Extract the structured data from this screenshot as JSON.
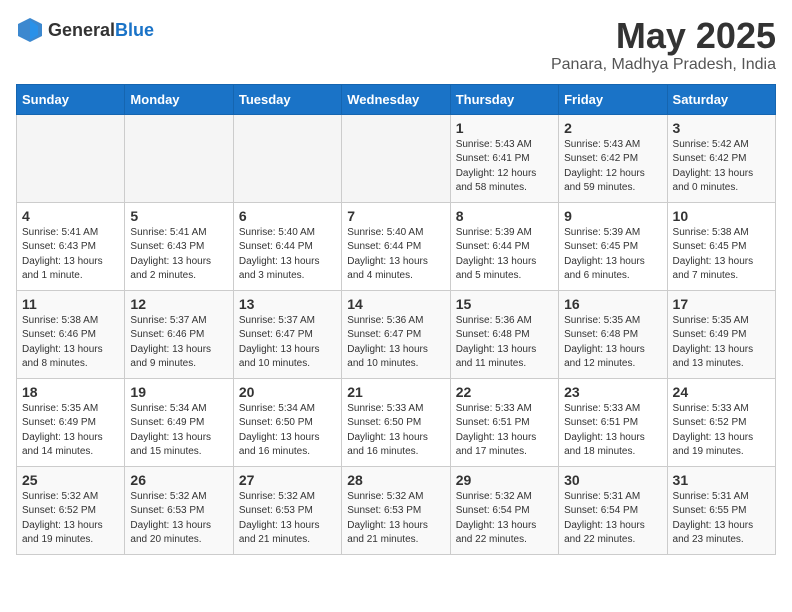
{
  "header": {
    "logo_general": "General",
    "logo_blue": "Blue",
    "month_year": "May 2025",
    "location": "Panara, Madhya Pradesh, India"
  },
  "weekdays": [
    "Sunday",
    "Monday",
    "Tuesday",
    "Wednesday",
    "Thursday",
    "Friday",
    "Saturday"
  ],
  "weeks": [
    [
      {
        "day": "",
        "info": ""
      },
      {
        "day": "",
        "info": ""
      },
      {
        "day": "",
        "info": ""
      },
      {
        "day": "",
        "info": ""
      },
      {
        "day": "1",
        "info": "Sunrise: 5:43 AM\nSunset: 6:41 PM\nDaylight: 12 hours\nand 58 minutes."
      },
      {
        "day": "2",
        "info": "Sunrise: 5:43 AM\nSunset: 6:42 PM\nDaylight: 12 hours\nand 59 minutes."
      },
      {
        "day": "3",
        "info": "Sunrise: 5:42 AM\nSunset: 6:42 PM\nDaylight: 13 hours\nand 0 minutes."
      }
    ],
    [
      {
        "day": "4",
        "info": "Sunrise: 5:41 AM\nSunset: 6:43 PM\nDaylight: 13 hours\nand 1 minute."
      },
      {
        "day": "5",
        "info": "Sunrise: 5:41 AM\nSunset: 6:43 PM\nDaylight: 13 hours\nand 2 minutes."
      },
      {
        "day": "6",
        "info": "Sunrise: 5:40 AM\nSunset: 6:44 PM\nDaylight: 13 hours\nand 3 minutes."
      },
      {
        "day": "7",
        "info": "Sunrise: 5:40 AM\nSunset: 6:44 PM\nDaylight: 13 hours\nand 4 minutes."
      },
      {
        "day": "8",
        "info": "Sunrise: 5:39 AM\nSunset: 6:44 PM\nDaylight: 13 hours\nand 5 minutes."
      },
      {
        "day": "9",
        "info": "Sunrise: 5:39 AM\nSunset: 6:45 PM\nDaylight: 13 hours\nand 6 minutes."
      },
      {
        "day": "10",
        "info": "Sunrise: 5:38 AM\nSunset: 6:45 PM\nDaylight: 13 hours\nand 7 minutes."
      }
    ],
    [
      {
        "day": "11",
        "info": "Sunrise: 5:38 AM\nSunset: 6:46 PM\nDaylight: 13 hours\nand 8 minutes."
      },
      {
        "day": "12",
        "info": "Sunrise: 5:37 AM\nSunset: 6:46 PM\nDaylight: 13 hours\nand 9 minutes."
      },
      {
        "day": "13",
        "info": "Sunrise: 5:37 AM\nSunset: 6:47 PM\nDaylight: 13 hours\nand 10 minutes."
      },
      {
        "day": "14",
        "info": "Sunrise: 5:36 AM\nSunset: 6:47 PM\nDaylight: 13 hours\nand 10 minutes."
      },
      {
        "day": "15",
        "info": "Sunrise: 5:36 AM\nSunset: 6:48 PM\nDaylight: 13 hours\nand 11 minutes."
      },
      {
        "day": "16",
        "info": "Sunrise: 5:35 AM\nSunset: 6:48 PM\nDaylight: 13 hours\nand 12 minutes."
      },
      {
        "day": "17",
        "info": "Sunrise: 5:35 AM\nSunset: 6:49 PM\nDaylight: 13 hours\nand 13 minutes."
      }
    ],
    [
      {
        "day": "18",
        "info": "Sunrise: 5:35 AM\nSunset: 6:49 PM\nDaylight: 13 hours\nand 14 minutes."
      },
      {
        "day": "19",
        "info": "Sunrise: 5:34 AM\nSunset: 6:49 PM\nDaylight: 13 hours\nand 15 minutes."
      },
      {
        "day": "20",
        "info": "Sunrise: 5:34 AM\nSunset: 6:50 PM\nDaylight: 13 hours\nand 16 minutes."
      },
      {
        "day": "21",
        "info": "Sunrise: 5:33 AM\nSunset: 6:50 PM\nDaylight: 13 hours\nand 16 minutes."
      },
      {
        "day": "22",
        "info": "Sunrise: 5:33 AM\nSunset: 6:51 PM\nDaylight: 13 hours\nand 17 minutes."
      },
      {
        "day": "23",
        "info": "Sunrise: 5:33 AM\nSunset: 6:51 PM\nDaylight: 13 hours\nand 18 minutes."
      },
      {
        "day": "24",
        "info": "Sunrise: 5:33 AM\nSunset: 6:52 PM\nDaylight: 13 hours\nand 19 minutes."
      }
    ],
    [
      {
        "day": "25",
        "info": "Sunrise: 5:32 AM\nSunset: 6:52 PM\nDaylight: 13 hours\nand 19 minutes."
      },
      {
        "day": "26",
        "info": "Sunrise: 5:32 AM\nSunset: 6:53 PM\nDaylight: 13 hours\nand 20 minutes."
      },
      {
        "day": "27",
        "info": "Sunrise: 5:32 AM\nSunset: 6:53 PM\nDaylight: 13 hours\nand 21 minutes."
      },
      {
        "day": "28",
        "info": "Sunrise: 5:32 AM\nSunset: 6:53 PM\nDaylight: 13 hours\nand 21 minutes."
      },
      {
        "day": "29",
        "info": "Sunrise: 5:32 AM\nSunset: 6:54 PM\nDaylight: 13 hours\nand 22 minutes."
      },
      {
        "day": "30",
        "info": "Sunrise: 5:31 AM\nSunset: 6:54 PM\nDaylight: 13 hours\nand 22 minutes."
      },
      {
        "day": "31",
        "info": "Sunrise: 5:31 AM\nSunset: 6:55 PM\nDaylight: 13 hours\nand 23 minutes."
      }
    ]
  ]
}
